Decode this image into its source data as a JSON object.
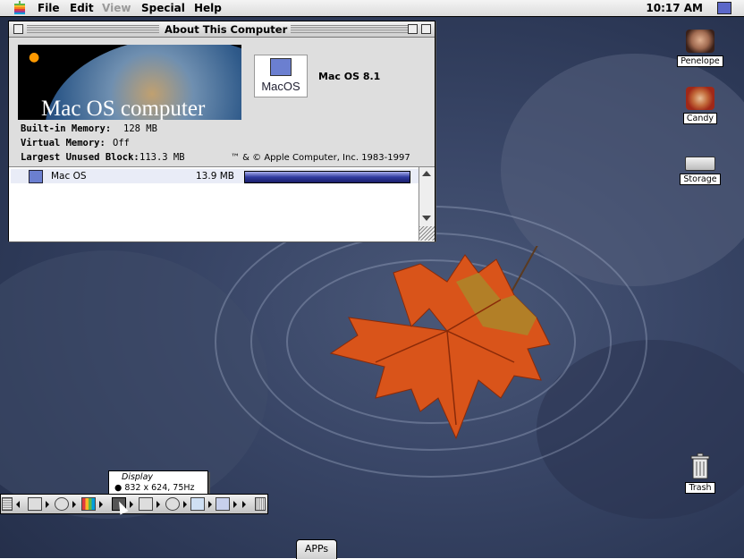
{
  "menubar": {
    "items": [
      "File",
      "Edit",
      "View",
      "Special",
      "Help"
    ],
    "clock": "10:17 AM"
  },
  "window": {
    "title": "About This Computer",
    "banner_text": "Mac OS computer",
    "logo_text": "MacOS",
    "version": "Mac OS 8.1",
    "builtin_label": "Built-in Memory:",
    "builtin_value": "128 MB",
    "virtual_label": "Virtual Memory:",
    "virtual_value": "Off",
    "largest_label": "Largest Unused Block:",
    "largest_value": "113.3 MB",
    "copyright": "™ & © Apple Computer, Inc. 1983-1997",
    "apps": [
      {
        "name": "Mac OS",
        "size": "13.9 MB",
        "usage": 1.0
      }
    ]
  },
  "desktop_icons": [
    {
      "label": "Penelope",
      "icon": "person-icon"
    },
    {
      "label": "Candy",
      "icon": "person-icon"
    },
    {
      "label": "Storage",
      "icon": "drive-icon"
    },
    {
      "label": "Trash",
      "icon": "trash-icon"
    }
  ],
  "control_strip": {
    "tooltip_title": "Display",
    "tooltip_value": "832 x 624, 75Hz"
  },
  "apps_tab": "APPs",
  "colors": {
    "menubar": "#dcdcdc",
    "desktop": "#34405e",
    "memory_bar": "#303aa0",
    "leaf": "#d9541a"
  }
}
